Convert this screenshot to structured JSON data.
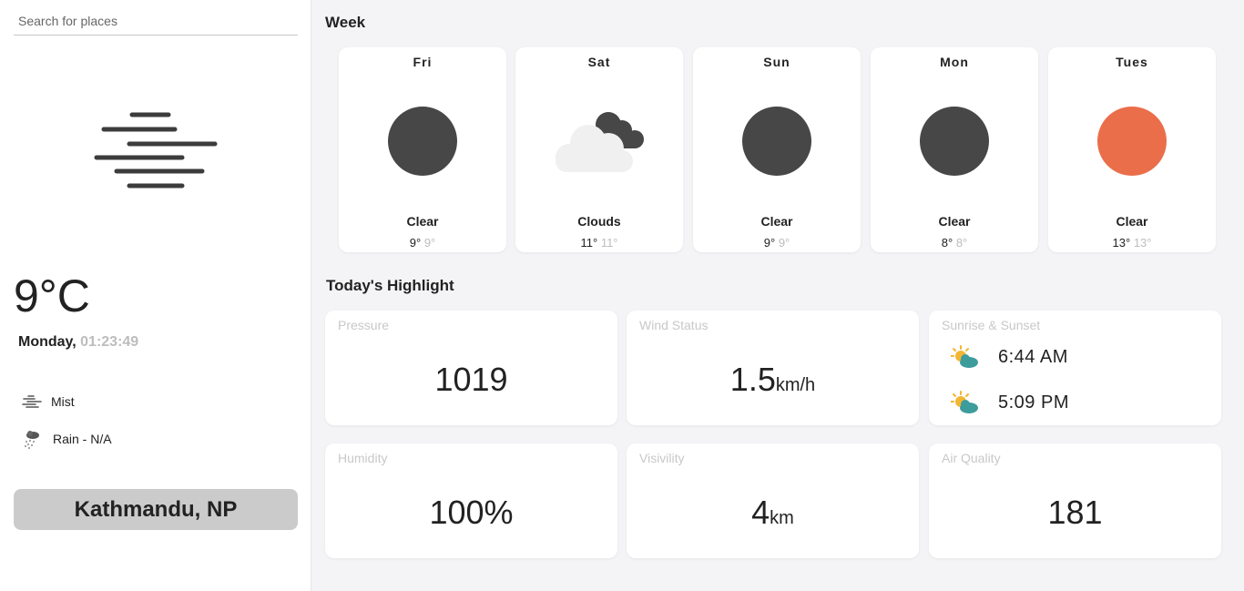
{
  "sidebar": {
    "search_placeholder": "Search for places",
    "main_icon": "mist-icon",
    "temperature": "9°C",
    "day": "Monday,",
    "time": "01:23:49",
    "conditions": [
      {
        "icon": "mist-icon",
        "label": "Mist"
      },
      {
        "icon": "rain-icon",
        "label": "Rain - N/A"
      }
    ],
    "location": "Kathmandu, NP"
  },
  "week": {
    "title": "Week",
    "days": [
      {
        "name": "Fri",
        "icon": "moon-icon",
        "desc": "Clear",
        "max": "9°",
        "min": "9°"
      },
      {
        "name": "Sat",
        "icon": "clouds-icon",
        "desc": "Clouds",
        "max": "11°",
        "min": "11°"
      },
      {
        "name": "Sun",
        "icon": "moon-icon",
        "desc": "Clear",
        "max": "9°",
        "min": "9°"
      },
      {
        "name": "Mon",
        "icon": "moon-icon",
        "desc": "Clear",
        "max": "8°",
        "min": "8°"
      },
      {
        "name": "Tues",
        "icon": "sun-icon",
        "desc": "Clear",
        "max": "13°",
        "min": "13°"
      }
    ]
  },
  "highlights": {
    "title": "Today's Highlight",
    "pressure": {
      "label": "Pressure",
      "value": "1019"
    },
    "wind": {
      "label": "Wind Status",
      "value": "1.5",
      "unit": "km/h"
    },
    "sun": {
      "label": "Sunrise & Sunset",
      "sunrise": "6:44 AM",
      "sunset": "5:09 PM"
    },
    "humidity": {
      "label": "Humidity",
      "value": "100%"
    },
    "visibility": {
      "label": "Visivility",
      "value": "4",
      "unit": "km"
    },
    "air_quality": {
      "label": "Air Quality",
      "value": "181"
    }
  },
  "colors": {
    "moon": "#474747",
    "sun": "#eb6e4b",
    "cloud_light": "#f0f0f0",
    "location_bg": "#cbcbcb"
  }
}
